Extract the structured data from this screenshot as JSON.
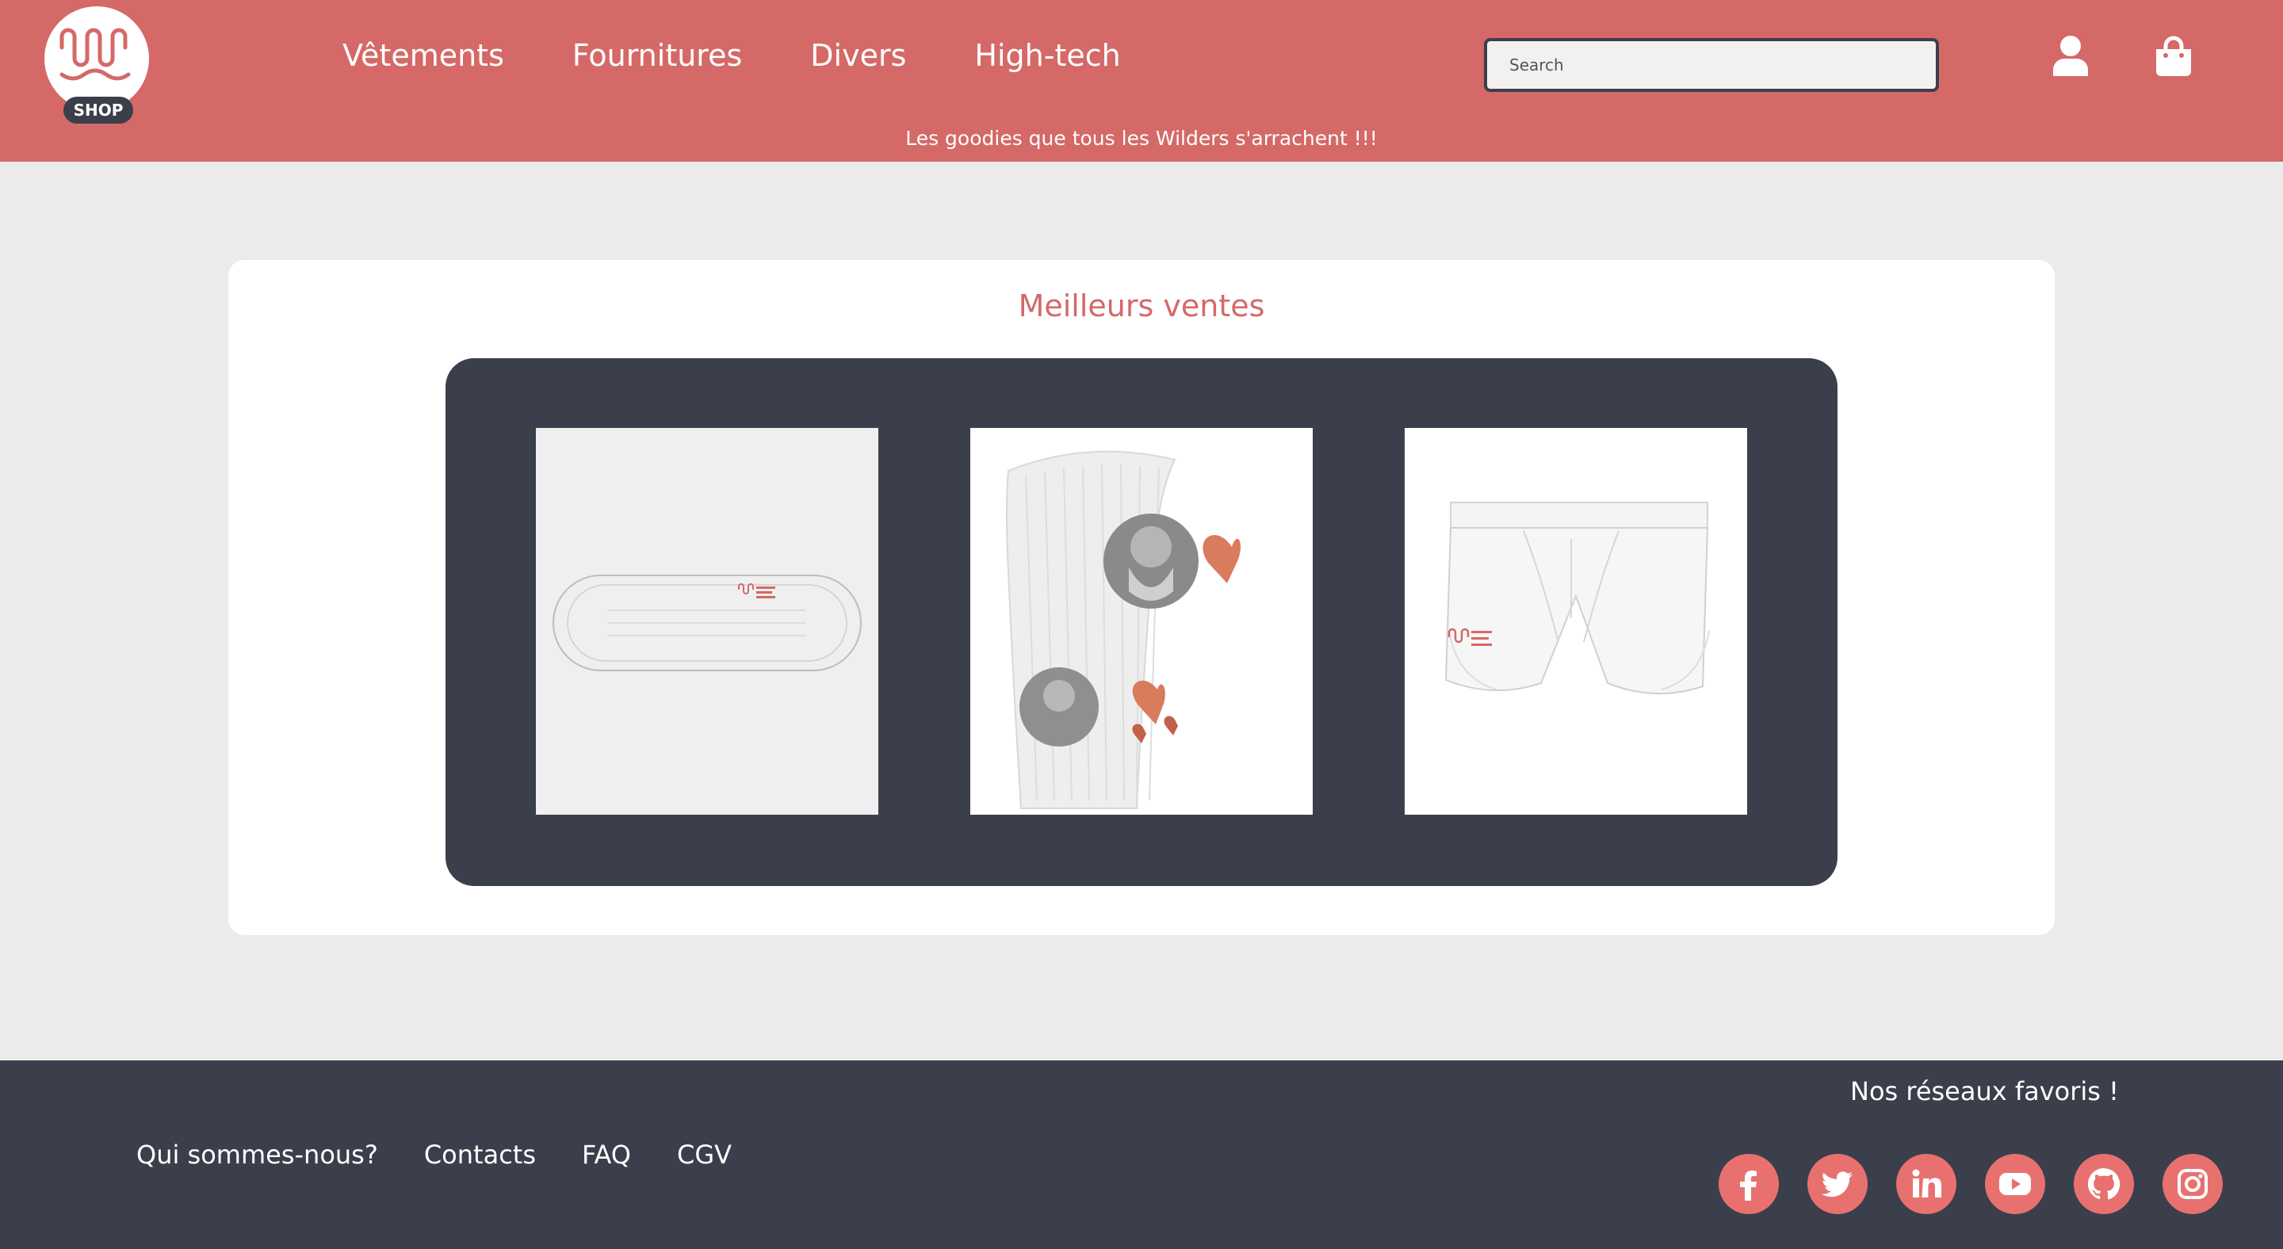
{
  "header": {
    "logo_text": "SHOP",
    "nav": [
      "Vêtements",
      "Fournitures",
      "Divers",
      "High-tech"
    ],
    "search_placeholder": "Search",
    "tagline": "Les goodies que tous les Wilders s'arrachent !!!"
  },
  "main": {
    "title": "Meilleurs ventes",
    "products": [
      {
        "image": "face-mask-image"
      },
      {
        "image": "sock-image"
      },
      {
        "image": "boxer-briefs-image"
      }
    ]
  },
  "footer": {
    "links": [
      "Qui sommes-nous?",
      "Contacts",
      "FAQ",
      "CGV"
    ],
    "social_title": "Nos réseaux favoris !",
    "socials": [
      "facebook-icon",
      "twitter-icon",
      "linkedin-icon",
      "youtube-icon",
      "github-icon",
      "instagram-icon"
    ]
  },
  "colors": {
    "brand": "#d46967",
    "dark": "#3b3f4b",
    "social": "#e8716f",
    "background": "#ebebeb"
  }
}
